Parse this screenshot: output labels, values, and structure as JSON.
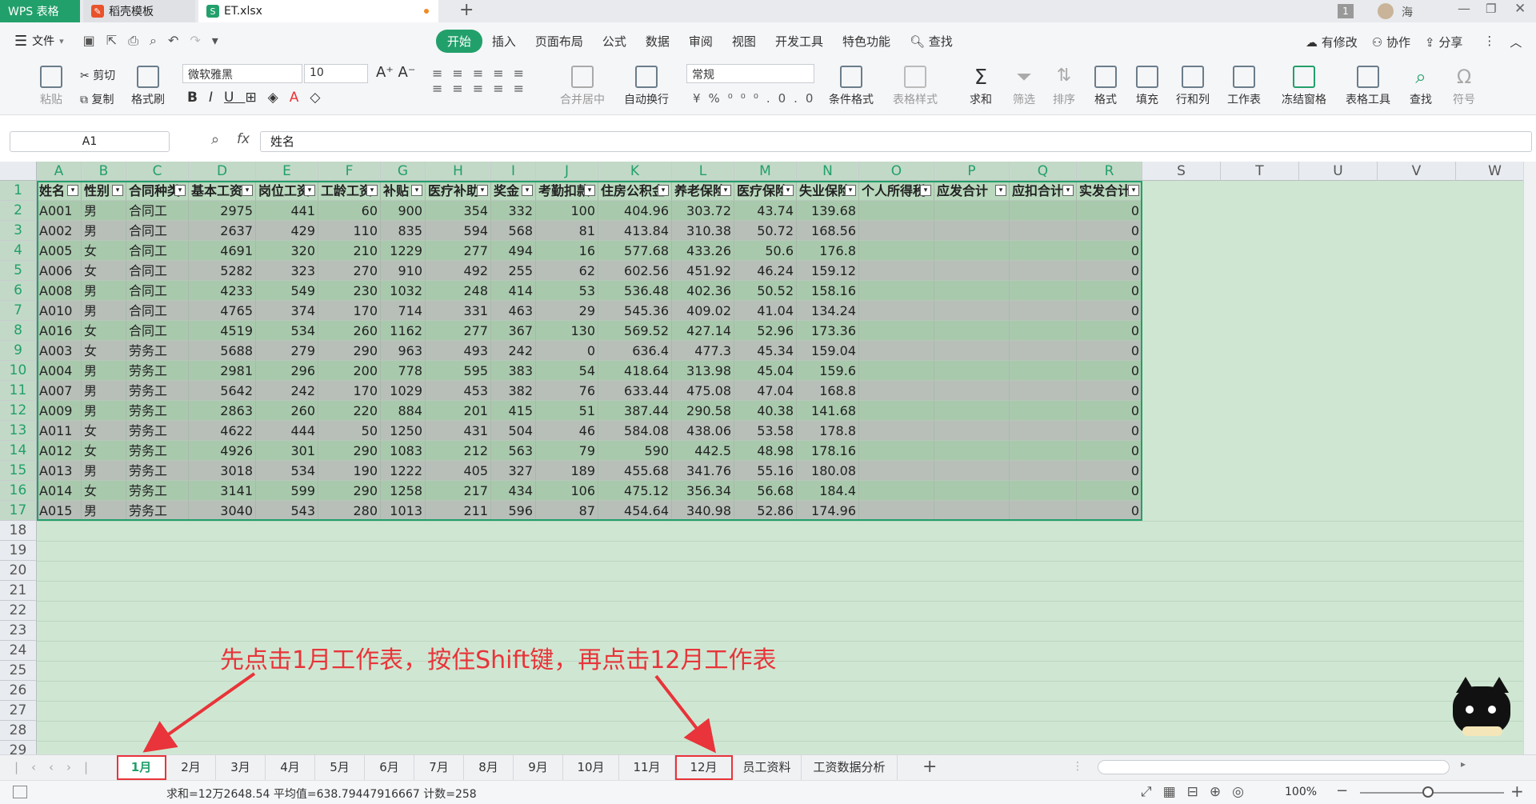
{
  "titlebar": {
    "tabs": [
      {
        "label": "WPS 表格"
      },
      {
        "label": "稻壳模板"
      },
      {
        "label": "ET.xlsx"
      }
    ],
    "badge": "1",
    "user": "海"
  },
  "menu": {
    "file": "文件",
    "items": [
      "开始",
      "插入",
      "页面布局",
      "公式",
      "数据",
      "审阅",
      "视图",
      "开发工具",
      "特色功能"
    ],
    "search": "查找",
    "right": [
      "有修改",
      "协作",
      "分享"
    ]
  },
  "ribbon": {
    "paste": "粘贴",
    "cut": "剪切",
    "copy": "复制",
    "format_painter": "格式刷",
    "font": "微软雅黑",
    "size": "10",
    "number_format": "常规",
    "merge": "合并居中",
    "wrap": "自动换行",
    "cond_format": "条件格式",
    "table_style": "表格样式",
    "sum": "求和",
    "filter": "筛选",
    "sort": "排序",
    "format": "格式",
    "fill": "填充",
    "rowcol": "行和列",
    "worksheet": "工作表",
    "freeze": "冻结窗格",
    "table_tools": "表格工具",
    "find": "查找",
    "symbol": "符号"
  },
  "formula": {
    "namebox": "A1",
    "fx": "fx",
    "value": "姓名"
  },
  "columns": [
    "A",
    "B",
    "C",
    "D",
    "E",
    "F",
    "G",
    "H",
    "I",
    "J",
    "K",
    "L",
    "M",
    "N",
    "O",
    "P",
    "Q",
    "R",
    "S",
    "T",
    "U",
    "V",
    "W"
  ],
  "headers": [
    "姓名",
    "性别",
    "合同种类",
    "基本工资",
    "岗位工资",
    "工龄工资",
    "补贴",
    "医疗补助",
    "奖金",
    "考勤扣款",
    "住房公积金",
    "养老保险",
    "医疗保险",
    "失业保险",
    "个人所得税",
    "应发合计",
    "应扣合计",
    "实发合计"
  ],
  "rows": [
    [
      "A001",
      "男",
      "合同工",
      "2975",
      "441",
      "60",
      "900",
      "354",
      "332",
      "100",
      "404.96",
      "303.72",
      "43.74",
      "139.68",
      "",
      "",
      "",
      "0"
    ],
    [
      "A002",
      "男",
      "合同工",
      "2637",
      "429",
      "110",
      "835",
      "594",
      "568",
      "81",
      "413.84",
      "310.38",
      "50.72",
      "168.56",
      "",
      "",
      "",
      "0"
    ],
    [
      "A005",
      "女",
      "合同工",
      "4691",
      "320",
      "210",
      "1229",
      "277",
      "494",
      "16",
      "577.68",
      "433.26",
      "50.6",
      "176.8",
      "",
      "",
      "",
      "0"
    ],
    [
      "A006",
      "女",
      "合同工",
      "5282",
      "323",
      "270",
      "910",
      "492",
      "255",
      "62",
      "602.56",
      "451.92",
      "46.24",
      "159.12",
      "",
      "",
      "",
      "0"
    ],
    [
      "A008",
      "男",
      "合同工",
      "4233",
      "549",
      "230",
      "1032",
      "248",
      "414",
      "53",
      "536.48",
      "402.36",
      "50.52",
      "158.16",
      "",
      "",
      "",
      "0"
    ],
    [
      "A010",
      "男",
      "合同工",
      "4765",
      "374",
      "170",
      "714",
      "331",
      "463",
      "29",
      "545.36",
      "409.02",
      "41.04",
      "134.24",
      "",
      "",
      "",
      "0"
    ],
    [
      "A016",
      "女",
      "合同工",
      "4519",
      "534",
      "260",
      "1162",
      "277",
      "367",
      "130",
      "569.52",
      "427.14",
      "52.96",
      "173.36",
      "",
      "",
      "",
      "0"
    ],
    [
      "A003",
      "女",
      "劳务工",
      "5688",
      "279",
      "290",
      "963",
      "493",
      "242",
      "0",
      "636.4",
      "477.3",
      "45.34",
      "159.04",
      "",
      "",
      "",
      "0"
    ],
    [
      "A004",
      "男",
      "劳务工",
      "2981",
      "296",
      "200",
      "778",
      "595",
      "383",
      "54",
      "418.64",
      "313.98",
      "45.04",
      "159.6",
      "",
      "",
      "",
      "0"
    ],
    [
      "A007",
      "男",
      "劳务工",
      "5642",
      "242",
      "170",
      "1029",
      "453",
      "382",
      "76",
      "633.44",
      "475.08",
      "47.04",
      "168.8",
      "",
      "",
      "",
      "0"
    ],
    [
      "A009",
      "男",
      "劳务工",
      "2863",
      "260",
      "220",
      "884",
      "201",
      "415",
      "51",
      "387.44",
      "290.58",
      "40.38",
      "141.68",
      "",
      "",
      "",
      "0"
    ],
    [
      "A011",
      "女",
      "劳务工",
      "4622",
      "444",
      "50",
      "1250",
      "431",
      "504",
      "46",
      "584.08",
      "438.06",
      "53.58",
      "178.8",
      "",
      "",
      "",
      "0"
    ],
    [
      "A012",
      "女",
      "劳务工",
      "4926",
      "301",
      "290",
      "1083",
      "212",
      "563",
      "79",
      "590",
      "442.5",
      "48.98",
      "178.16",
      "",
      "",
      "",
      "0"
    ],
    [
      "A013",
      "男",
      "劳务工",
      "3018",
      "534",
      "190",
      "1222",
      "405",
      "327",
      "189",
      "455.68",
      "341.76",
      "55.16",
      "180.08",
      "",
      "",
      "",
      "0"
    ],
    [
      "A014",
      "女",
      "劳务工",
      "3141",
      "599",
      "290",
      "1258",
      "217",
      "434",
      "106",
      "475.12",
      "356.34",
      "56.68",
      "184.4",
      "",
      "",
      "",
      "0"
    ],
    [
      "A015",
      "男",
      "劳务工",
      "3040",
      "543",
      "280",
      "1013",
      "211",
      "596",
      "87",
      "454.64",
      "340.98",
      "52.86",
      "174.96",
      "",
      "",
      "",
      "0"
    ]
  ],
  "row_numbers": [
    "1",
    "2",
    "3",
    "4",
    "5",
    "6",
    "7",
    "8",
    "9",
    "10",
    "11",
    "12",
    "13",
    "14",
    "15",
    "16",
    "17",
    "18",
    "19",
    "20",
    "21",
    "22",
    "23",
    "24",
    "25",
    "26",
    "27",
    "28",
    "29"
  ],
  "annotation": "先点击1月工作表，按住Shift键，再点击12月工作表",
  "sheets": [
    "1月",
    "2月",
    "3月",
    "4月",
    "5月",
    "6月",
    "7月",
    "8月",
    "9月",
    "10月",
    "11月",
    "12月",
    "员工资料",
    "工资数据分析"
  ],
  "status": {
    "summary": "求和=12万2648.54  平均值=638.79447916667  计数=258",
    "zoom": "100%"
  },
  "colors": {
    "accent": "#22a06b",
    "selection": "#cfe7d2",
    "annotation": "#e8343a"
  }
}
